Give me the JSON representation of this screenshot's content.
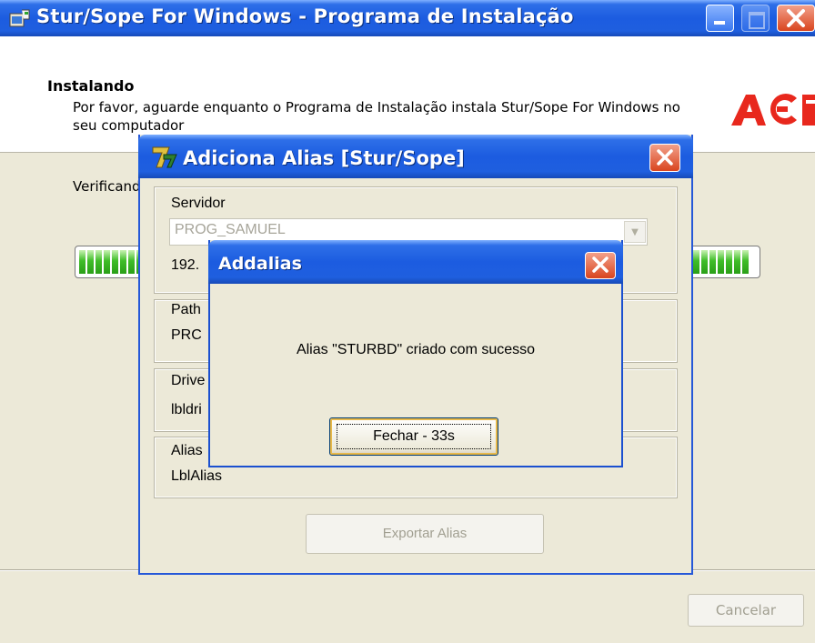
{
  "main_window": {
    "title": "Stur/Sope For Windows - Programa de Instalação",
    "header_title": "Instalando",
    "header_subtitle": "Por favor, aguarde enquanto o Programa de Instalação instala Stur/Sope For Windows no seu computador",
    "status_text": "Verificando",
    "progress_percent": 100,
    "cancel_label": "Cancelar",
    "logo_text": "ACI"
  },
  "alias_dialog": {
    "title": "Adiciona Alias [Stur/Sope]",
    "server_label": "Servidor",
    "server_value": "PROG_SAMUEL",
    "ip_value": "192.",
    "path_label": "Path",
    "path_value": "PRC",
    "driver_label": "Drive",
    "driver_value": "lbldri",
    "alias_label": "Alias",
    "alias_value": "LblAlias",
    "export_label": "Exportar Alias"
  },
  "message_box": {
    "title": "Addalias",
    "message": "Alias \"STURBD\" criado com sucesso",
    "button_label": "Fechar - 33s"
  },
  "colors": {
    "titlebar_blue": "#1c5ce0",
    "window_bg": "#ece9d8",
    "close_red": "#d9451f",
    "progress_green": "#3fbd28",
    "logo_red": "#e8281d"
  }
}
